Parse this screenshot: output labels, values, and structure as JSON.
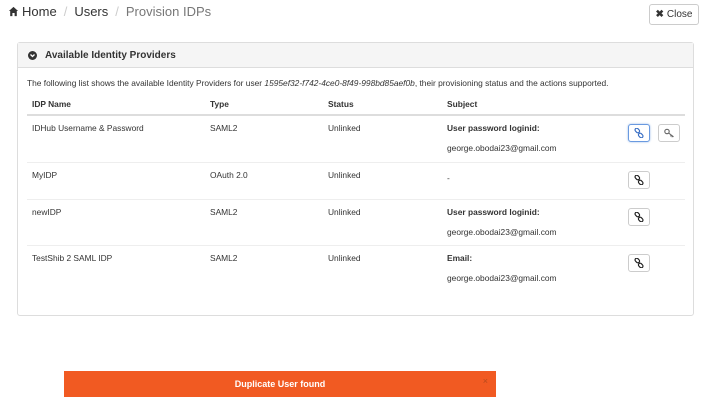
{
  "breadcrumb": {
    "home": "Home",
    "users": "Users",
    "current": "Provision IDPs"
  },
  "close_button": "Close",
  "panel": {
    "title": "Available Identity Providers",
    "intro_prefix": "The following list shows the available Identity Providers for user ",
    "user_id": "1595ef32-f742-4ce0-8f49-998bd85aef0b",
    "intro_suffix": ", their provisioning status and the actions supported."
  },
  "table": {
    "headers": [
      "IDP Name",
      "Type",
      "Status",
      "Subject"
    ],
    "rows": [
      {
        "name": "IDHub Username & Password",
        "type": "SAML2",
        "status": "Unlinked",
        "subject_label": "User password loginid:",
        "subject_value": "george.obodai23@gmail.com"
      },
      {
        "name": "MyIDP",
        "type": "OAuth 2.0",
        "status": "Unlinked",
        "subject_label": "",
        "subject_value": "-"
      },
      {
        "name": "newIDP",
        "type": "SAML2",
        "status": "Unlinked",
        "subject_label": "User password loginid:",
        "subject_value": "george.obodai23@gmail.com"
      },
      {
        "name": "TestShib 2 SAML IDP",
        "type": "SAML2",
        "status": "Unlinked",
        "subject_label": "Email:",
        "subject_value": "george.obodai23@gmail.com"
      }
    ]
  },
  "toast": {
    "message": "Duplicate User found",
    "close": "×"
  },
  "colors": {
    "toast": "#f15a22",
    "link_icon": "#3a6fc4"
  },
  "icons": [
    "home-icon",
    "close-icon",
    "chevron-down-icon",
    "link-icon",
    "key-icon"
  ]
}
